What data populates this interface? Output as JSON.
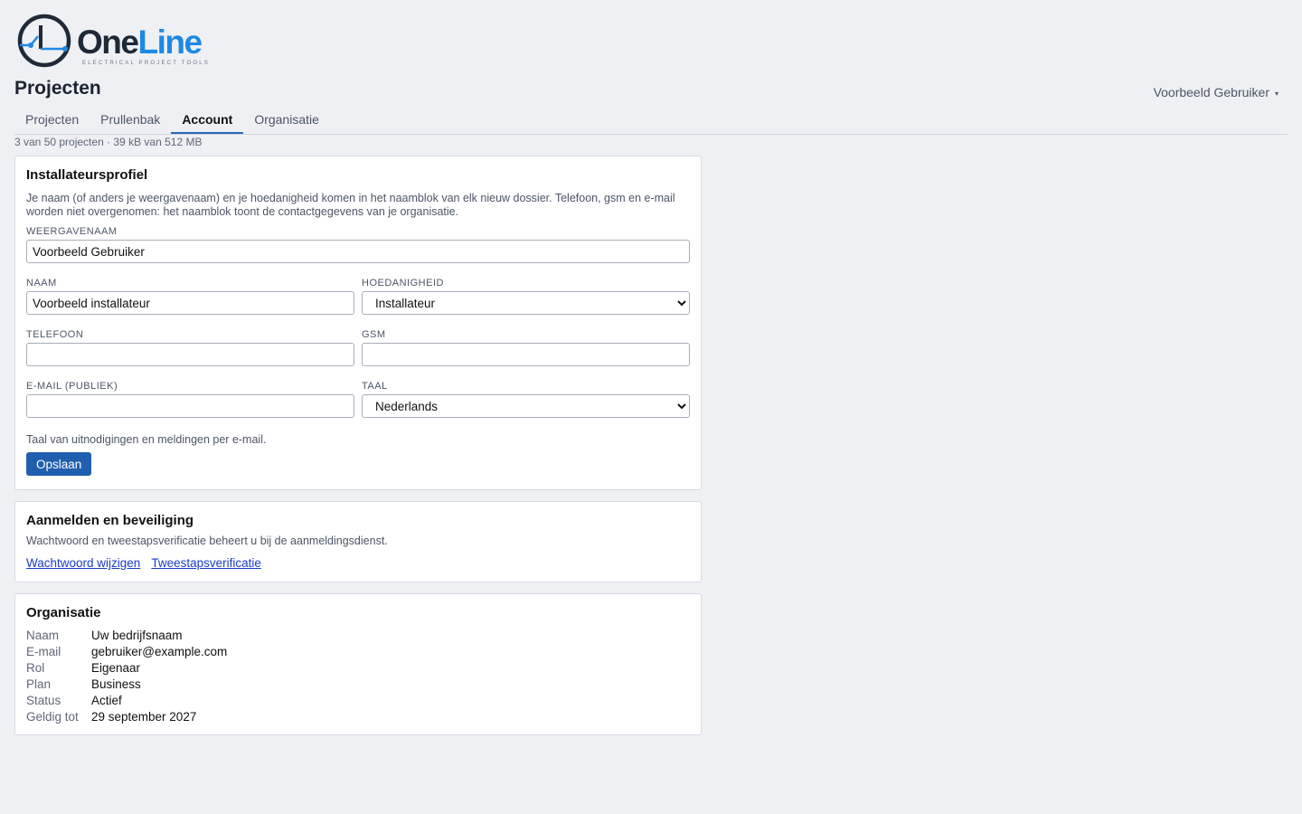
{
  "brand": {
    "logo_text_dark": "One",
    "logo_text_accent": "Line",
    "tagline": "ELECTRICAL PROJECT TOOLS",
    "logo_glyph": "1",
    "colors": {
      "dark": "#1f2937",
      "accent": "#1e88e5"
    }
  },
  "header": {
    "title": "Projecten",
    "user_name": "Voorbeeld Gebruiker",
    "user_caret": "▾"
  },
  "tabs": [
    {
      "label": "Projecten",
      "active": false
    },
    {
      "label": "Prullenbak",
      "active": false
    },
    {
      "label": "Account",
      "active": true
    },
    {
      "label": "Organisatie",
      "active": false
    }
  ],
  "quota": "3 van 50 projecten · 39 kB van 512 MB",
  "profile": {
    "title": "Installateursprofiel",
    "description": "Je naam (of anders je weergavenaam) en je hoedanigheid komen in het naamblok van elk nieuw dossier. Telefoon, gsm en e-mail worden niet overgenomen: het naamblok toont de contactgegevens van je organisatie.",
    "display_name_label": "WEERGAVENAAM",
    "display_name_value": "Voorbeeld Gebruiker",
    "name_label": "NAAM",
    "name_value": "Voorbeeld installateur",
    "capacity_label": "HOEDANIGHEID",
    "capacity_value": "Installateur",
    "phone_label": "TELEFOON",
    "phone_value": "",
    "mobile_label": "GSM",
    "mobile_value": "",
    "email_label": "E-MAIL (PUBLIEK)",
    "email_value": "",
    "language_label": "TAAL",
    "language_value": "Nederlands",
    "language_hint": "Taal van uitnodigingen en meldingen per e-mail.",
    "save_label": "Opslaan",
    "accent_color": "#1f5fae"
  },
  "security": {
    "title": "Aanmelden en beveiliging",
    "description": "Wachtwoord en tweestapsverificatie beheert u bij de aanmeldingsdienst.",
    "change_password": "Wachtwoord wijzigen",
    "two_step": "Tweestapsverificatie"
  },
  "organisation": {
    "title": "Organisatie",
    "rows": [
      {
        "key": "Naam",
        "value": "Uw bedrijfsnaam"
      },
      {
        "key": "E-mail",
        "value": "gebruiker@example.com"
      },
      {
        "key": "Rol",
        "value": "Eigenaar"
      },
      {
        "key": "Plan",
        "value": "Business"
      },
      {
        "key": "Status",
        "value": "Actief"
      },
      {
        "key": "Geldig tot",
        "value": "29 september 2027"
      }
    ]
  }
}
